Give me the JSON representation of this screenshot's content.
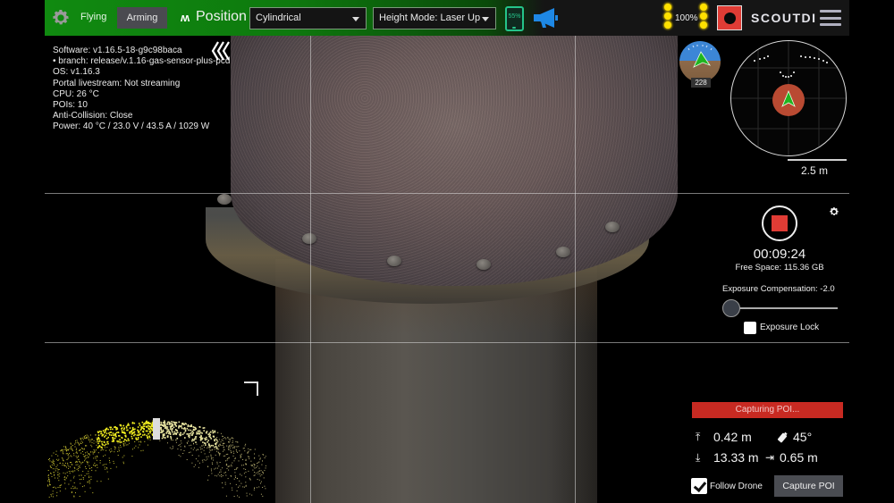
{
  "topbar": {
    "flight_status": "Flying",
    "arming_label": "Arming",
    "mode_label": "Position",
    "mode_icon": "waveform-icon",
    "coordinate_select": "Cylindrical",
    "height_mode_select": "Height Mode: Laser Up",
    "tablet_battery": "55%",
    "lights_percent": "100%",
    "brand": "SCOUTDI",
    "colors": {
      "bar_green": "#108a10",
      "battery_green": "#25c48a",
      "megaphone_blue": "#1e88e5",
      "record_red": "#e03c35"
    }
  },
  "info": {
    "lines": [
      "Software: v1.16.5-18-g9c98baca",
      "• branch: release/v.1.16-gas-sensor-plus-pcd",
      "OS: v1.16.3",
      "Portal livestream: Not streaming",
      "CPU: 26 °C",
      "POIs: 10",
      "Anti-Collision: Close",
      "Power: 40 °C / 23.0 V / 43.5 A / 1029 W"
    ]
  },
  "attitude": {
    "heading": "228"
  },
  "radar": {
    "scale_label": "2.5 m"
  },
  "recording": {
    "timer": "00:09:24",
    "free_space": "Free Space: 115.36 GB",
    "exposure_label": "Exposure Compensation: -2.0",
    "exposure_value": -2.0,
    "exposure_slider_fraction": 0.0,
    "exposure_lock_label": "Exposure Lock",
    "exposure_lock_checked": false
  },
  "poi": {
    "status": "Capturing POI...",
    "up_distance": "0.42 m",
    "camera_angle": "45°",
    "down_distance": "13.33 m",
    "forward_distance": "0.65 m",
    "follow_drone_label": "Follow Drone",
    "follow_drone_checked": true,
    "capture_button": "Capture POI"
  }
}
